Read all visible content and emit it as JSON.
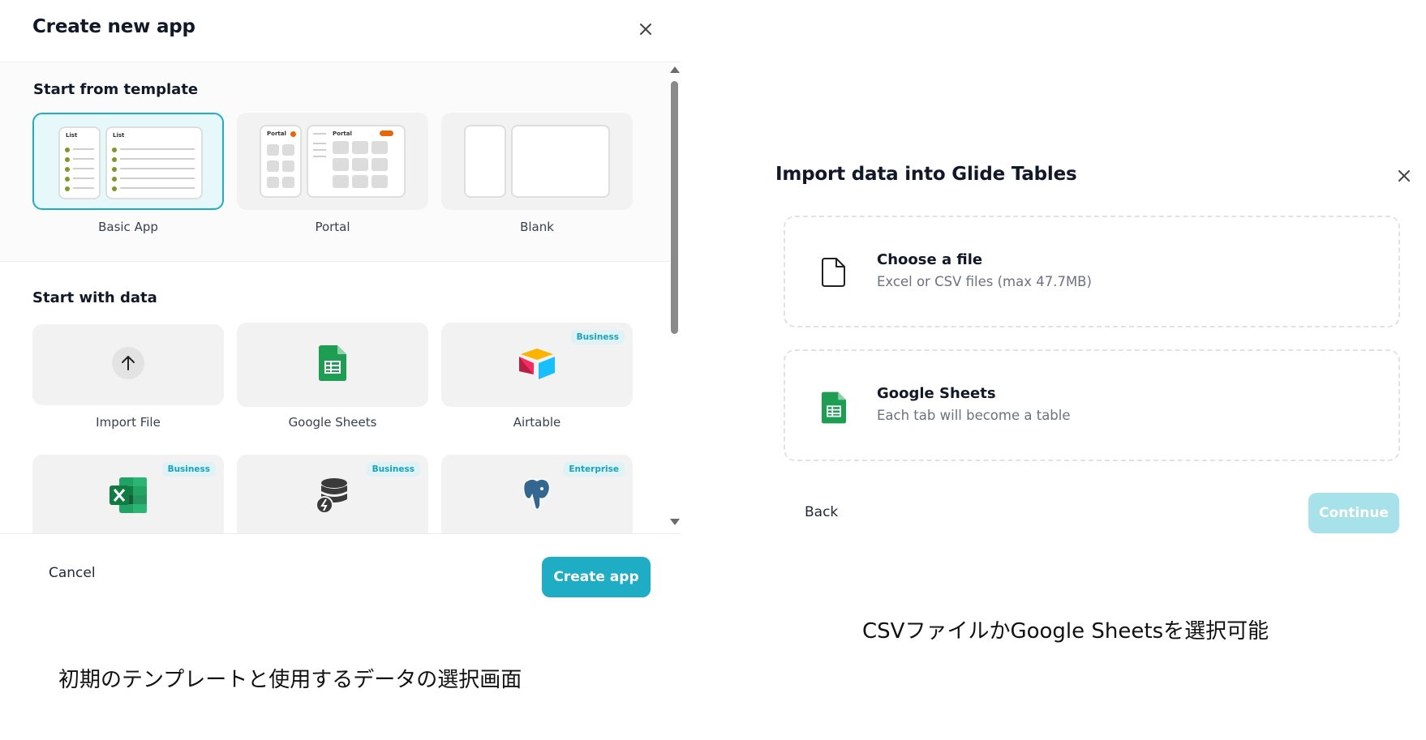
{
  "create_dialog": {
    "title": "Create new app",
    "start_from_template": {
      "title": "Start from template",
      "templates": [
        {
          "label": "Basic App",
          "selected": true,
          "mini_title": "List"
        },
        {
          "label": "Portal",
          "selected": false,
          "mini_title": "Portal"
        },
        {
          "label": "Blank",
          "selected": false
        }
      ]
    },
    "start_with_data": {
      "title": "Start with data",
      "sources": [
        {
          "label": "Import File",
          "icon": "arrow-up-icon",
          "badge": ""
        },
        {
          "label": "Google Sheets",
          "icon": "google-sheets-icon",
          "badge": ""
        },
        {
          "label": "Airtable",
          "icon": "airtable-icon",
          "badge": "Business"
        },
        {
          "label": "",
          "icon": "excel-icon",
          "badge": "Business"
        },
        {
          "label": "",
          "icon": "database-icon",
          "badge": "Business"
        },
        {
          "label": "",
          "icon": "postgresql-icon",
          "badge": "Enterprise"
        }
      ]
    },
    "footer": {
      "cancel_label": "Cancel",
      "create_label": "Create app"
    }
  },
  "import_dialog": {
    "title": "Import data into Glide Tables",
    "options": [
      {
        "title": "Choose a file",
        "subtitle": "Excel or CSV files (max 47.7MB)",
        "icon": "file-icon"
      },
      {
        "title": "Google Sheets",
        "subtitle": "Each tab will become a table",
        "icon": "google-sheets-icon"
      }
    ],
    "footer": {
      "back_label": "Back",
      "continue_label": "Continue",
      "continue_disabled": true
    }
  },
  "captions": {
    "left": "初期のテンプレートと使用するデータの選択画面",
    "right": "CSVファイルかGoogle Sheetsを選択可能"
  },
  "colors": {
    "accent": "#1eadc5",
    "accent_disabled": "#a7e1ea",
    "badge_text": "#1aa3b8",
    "badge_bg": "#dff3f7"
  }
}
